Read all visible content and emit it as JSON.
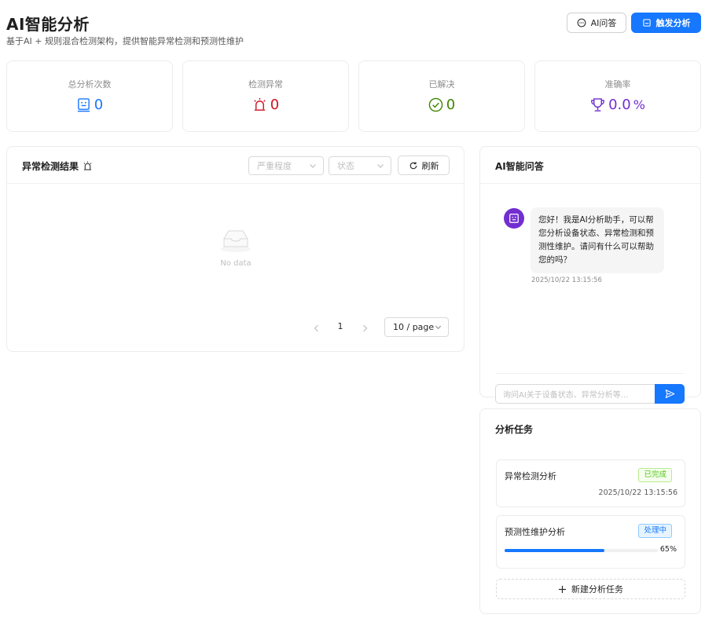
{
  "header": {
    "title": "AI智能分析",
    "subtitle": "基于AI + 规则混合检测架构，提供智能异常检测和预测性维护",
    "ai_qa_label": "AI问答",
    "trigger_label": "触发分析"
  },
  "stats": [
    {
      "label": "总分析次数",
      "value": "0",
      "icon": "robot-icon",
      "color": "#1677ff"
    },
    {
      "label": "检测异常",
      "value": "0",
      "icon": "alarm-icon",
      "color": "#cf1322"
    },
    {
      "label": "已解决",
      "value": "0",
      "icon": "check-circle-icon",
      "color": "#3f8600"
    },
    {
      "label": "准确率",
      "value": "0.0",
      "suffix": "%",
      "icon": "trophy-icon",
      "color": "#722ed1"
    }
  ],
  "anomaly": {
    "title": "异常检测结果",
    "severity_placeholder": "严重程度",
    "status_placeholder": "状态",
    "refresh_label": "刷新",
    "empty_text": "No data",
    "page": "1",
    "page_size": "10 / page"
  },
  "chat": {
    "title": "AI智能问答",
    "message": "您好！我是AI分析助手，可以帮您分析设备状态、异常检测和预测性维护。请问有什么可以帮助您的吗？",
    "time": "2025/10/22 13:15:56",
    "input_placeholder": "询问AI关于设备状态、异常分析等..."
  },
  "tasks": {
    "title": "分析任务",
    "items": [
      {
        "name": "异常检测分析",
        "status": "已完成",
        "time": "2025/10/22 13:15:56"
      },
      {
        "name": "预测性维护分析",
        "status": "处理中",
        "progress": 65,
        "progress_text": "65%"
      }
    ],
    "new_task_label": "新建分析任务"
  },
  "colors": {
    "primary": "#1677ff",
    "danger": "#cf1322",
    "success": "#3f8600",
    "purple": "#722ed1"
  }
}
